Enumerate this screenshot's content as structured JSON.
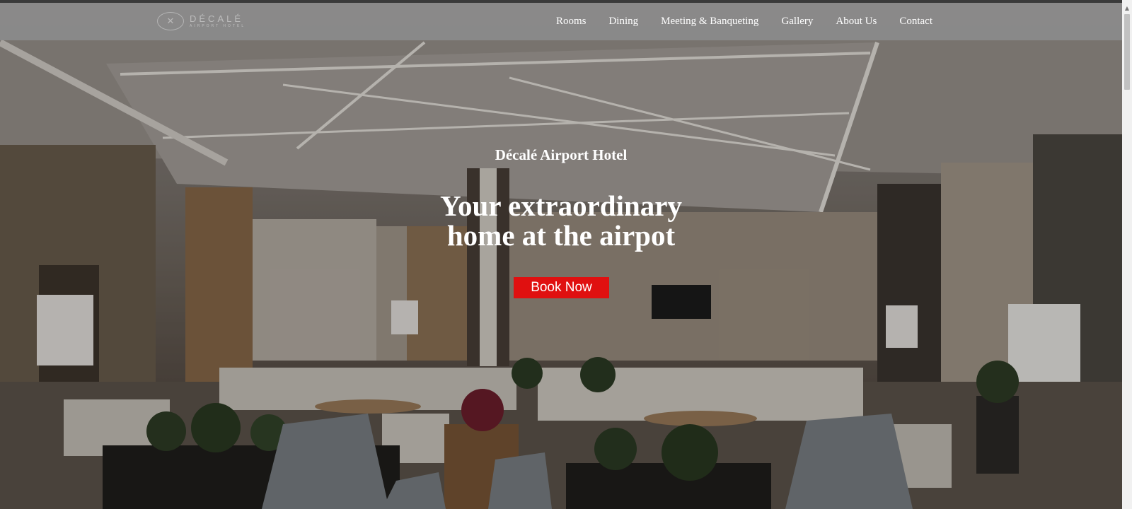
{
  "header": {
    "logo": {
      "mark": "✕",
      "word": "DÉCALÉ",
      "sub": "AIRPORT HOTEL",
      "icon": "hotel-logo"
    },
    "nav": [
      {
        "label": "Rooms"
      },
      {
        "label": "Dining"
      },
      {
        "label": "Meeting & Banqueting"
      },
      {
        "label": "Gallery"
      },
      {
        "label": "About Us"
      },
      {
        "label": "Contact"
      }
    ]
  },
  "hero": {
    "hotel_name": "Décalé Airport Hotel",
    "headline_line1": "Your extraordinary",
    "headline_line2": "home at the airpot",
    "cta_label": "Book Now",
    "background": "hotel lobby photo"
  },
  "scrollbar": {
    "up_icon": "scroll-up-arrow-icon"
  },
  "colors": {
    "nav_bg": "#8c8c8c",
    "cta_bg": "#e01010",
    "text": "#ffffff"
  }
}
